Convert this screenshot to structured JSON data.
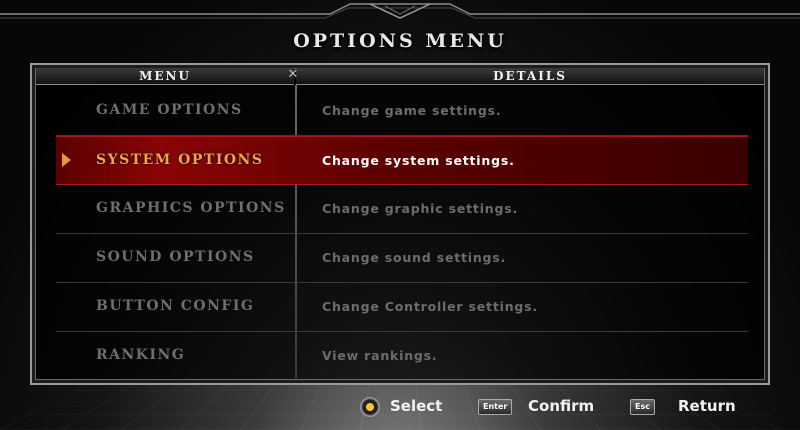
{
  "title": "OPTIONS MENU",
  "headers": {
    "menu": "MENU",
    "details": "DETAILS"
  },
  "rows": [
    {
      "label": "GAME OPTIONS",
      "detail": "Change game settings.",
      "selected": false
    },
    {
      "label": "SYSTEM OPTIONS",
      "detail": "Change system settings.",
      "selected": true
    },
    {
      "label": "GRAPHICS OPTIONS",
      "detail": "Change graphic settings.",
      "selected": false
    },
    {
      "label": "SOUND OPTIONS",
      "detail": "Change sound settings.",
      "selected": false
    },
    {
      "label": "BUTTON CONFIG",
      "detail": "Change Controller settings.",
      "selected": false
    },
    {
      "label": "RANKING",
      "detail": "View rankings.",
      "selected": false
    }
  ],
  "footer": {
    "select": {
      "icon": "dpad-icon",
      "label": "Select"
    },
    "confirm": {
      "key": "Enter",
      "label": "Confirm"
    },
    "return": {
      "key": "Esc",
      "label": "Return"
    }
  },
  "colors": {
    "selected_bg": "#8a0505",
    "selected_label": "#f2a24a",
    "dim_text": "#6e6e6e"
  }
}
